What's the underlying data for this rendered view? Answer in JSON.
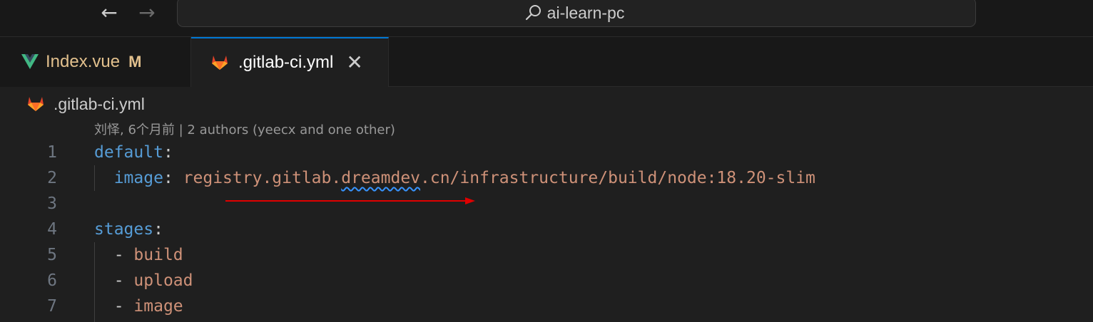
{
  "titlebar": {
    "back_icon": "arrow-left-icon",
    "forward_icon": "arrow-right-icon",
    "search_label": "ai-learn-pc",
    "search_icon": "search-icon"
  },
  "tabs": [
    {
      "label": "Index.vue",
      "badge": "M",
      "icon": "vue-icon",
      "active": false
    },
    {
      "label": ".gitlab-ci.yml",
      "close": "✕",
      "icon": "gitlab-icon",
      "active": true
    }
  ],
  "breadcrumb": {
    "label": ".gitlab-ci.yml",
    "icon": "gitlab-icon"
  },
  "blame": "刘怿, 6个月前 | 2 authors (yeecx and one other)",
  "code": {
    "lines": [
      {
        "n": "1",
        "key": "default",
        "colon": ":"
      },
      {
        "n": "2",
        "key": "image",
        "colon": ":",
        "value_pre": "registry.gitlab.",
        "value_squiggle": "dreamdev",
        "value_post": ".cn/infrastructure/build/node:18.20-slim"
      },
      {
        "n": "3"
      },
      {
        "n": "4",
        "key": "stages",
        "colon": ":"
      },
      {
        "n": "5",
        "dash": "-",
        "item": "build"
      },
      {
        "n": "6",
        "dash": "-",
        "item": "upload"
      },
      {
        "n": "7",
        "dash": "-",
        "item": "image"
      }
    ]
  },
  "colors": {
    "accent": "#0078d4",
    "keyword": "#569cd6",
    "string": "#ce9178",
    "modified": "#e2c08d",
    "annotation_arrow": "#e00000"
  }
}
